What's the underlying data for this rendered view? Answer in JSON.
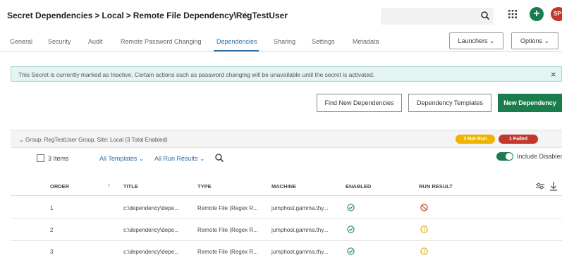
{
  "header": {
    "breadcrumb": [
      "Secret Dependencies",
      "Local",
      "Remote File Dependency\\RegTestUser"
    ],
    "breadcrumb_separator": ">",
    "favorite_icon": "star-outline-icon",
    "search_icon": "search-icon",
    "apps_icon": "grid-icon",
    "add_icon": "plus-icon",
    "avatar_initials": "SP",
    "add_button_color": "#1b7d4b",
    "avatar_color": "#c0392b"
  },
  "tabs": [
    {
      "label": "General"
    },
    {
      "label": "Security"
    },
    {
      "label": "Audit"
    },
    {
      "label": "Remote Password Changing"
    },
    {
      "label": "Dependencies",
      "active": true
    },
    {
      "label": "Sharing"
    },
    {
      "label": "Settings"
    },
    {
      "label": "Metadata"
    }
  ],
  "tab_actions": {
    "launchers": "Launchers",
    "options": "Options"
  },
  "alert": {
    "text": "This Secret is currently marked as Inactive. Certain actions such as password changing will be unavailable until the secret is activated.",
    "close": "×",
    "background": "#e3f4f1"
  },
  "actions": {
    "find": "Find New Dependencies",
    "templates": "Dependency Templates",
    "new": "New Dependency",
    "new_color": "#1b7d4b"
  },
  "group": {
    "label": "Group: RegTestUser Group, Site: Local (3 Total Enabled)",
    "badges": [
      {
        "text": "3 Not Run",
        "color": "#f0b400"
      },
      {
        "text": "1 Failed",
        "color": "#c0392b"
      }
    ]
  },
  "toolbar": {
    "items_label": "3 Items",
    "filter_templates": "All Templates",
    "filter_results": "All Run Results",
    "include_disabled": "Include Disabled",
    "include_disabled_on": true
  },
  "table": {
    "columns": [
      "ORDER",
      "TITLE",
      "TYPE",
      "MACHINE",
      "ENABLED",
      "RUN RESULT"
    ],
    "rows": [
      {
        "order": "1",
        "title": "c:\\dependency\\depe...",
        "type": "Remote File (Regex R...",
        "machine": "jumphost.gamma.thy...",
        "enabled": "check-circle-icon",
        "result": "failed-icon"
      },
      {
        "order": "2",
        "title": "c:\\dependency\\depe...",
        "type": "Remote File (Regex R...",
        "machine": "jumphost.gamma.thy...",
        "enabled": "check-circle-icon",
        "result": "not-run-icon"
      },
      {
        "order": "3",
        "title": "c:\\dependency\\depe...",
        "type": "Remote File (Regex R...",
        "machine": "jumphost.gamma.thy...",
        "enabled": "check-circle-icon",
        "result": "not-run-icon"
      }
    ]
  }
}
